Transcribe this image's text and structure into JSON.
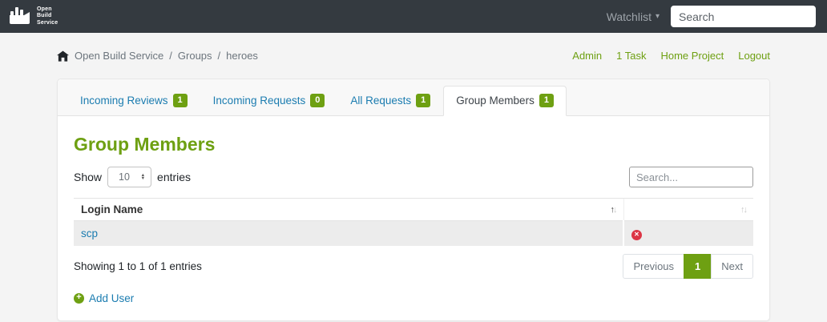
{
  "colors": {
    "navbar_bg": "#343a40",
    "brand_green": "#6ea012",
    "link_blue": "#1b7cb0",
    "danger_red": "#dc3545",
    "page_bg": "#f4f4f4",
    "row_stripe": "#ececec"
  },
  "icons": {
    "caret_down": "▾",
    "sort_asc": "↑",
    "sort_desc": "↓",
    "select_up": "▲",
    "select_down": "▼",
    "delete_glyph": "✕",
    "add_glyph": "+",
    "separator": "/"
  },
  "navbar": {
    "logo_lines": [
      "Open",
      "Build",
      "Service"
    ],
    "watchlist_label": "Watchlist",
    "search_placeholder": "Search"
  },
  "breadcrumb": {
    "items": [
      "Open Build Service",
      "Groups",
      "heroes"
    ]
  },
  "user_links": {
    "admin": "Admin",
    "tasks": "1 Task",
    "home_project": "Home Project",
    "logout": "Logout"
  },
  "tabs": [
    {
      "label": "Incoming Reviews",
      "badge": "1"
    },
    {
      "label": "Incoming Requests",
      "badge": "0"
    },
    {
      "label": "All Requests",
      "badge": "1"
    },
    {
      "label": "Group Members",
      "badge": "1"
    }
  ],
  "main": {
    "title": "Group Members",
    "show_label": "Show",
    "entries_label": "entries",
    "page_length": "10",
    "table_search_placeholder": "Search...",
    "table": {
      "columns": [
        {
          "label": "Login Name"
        },
        {
          "label": ""
        }
      ],
      "rows": [
        {
          "login": "scp"
        }
      ]
    },
    "info_text": "Showing 1 to 1 of 1 entries",
    "pagination": {
      "previous": "Previous",
      "page": "1",
      "next": "Next"
    },
    "add_user_label": "Add User"
  }
}
